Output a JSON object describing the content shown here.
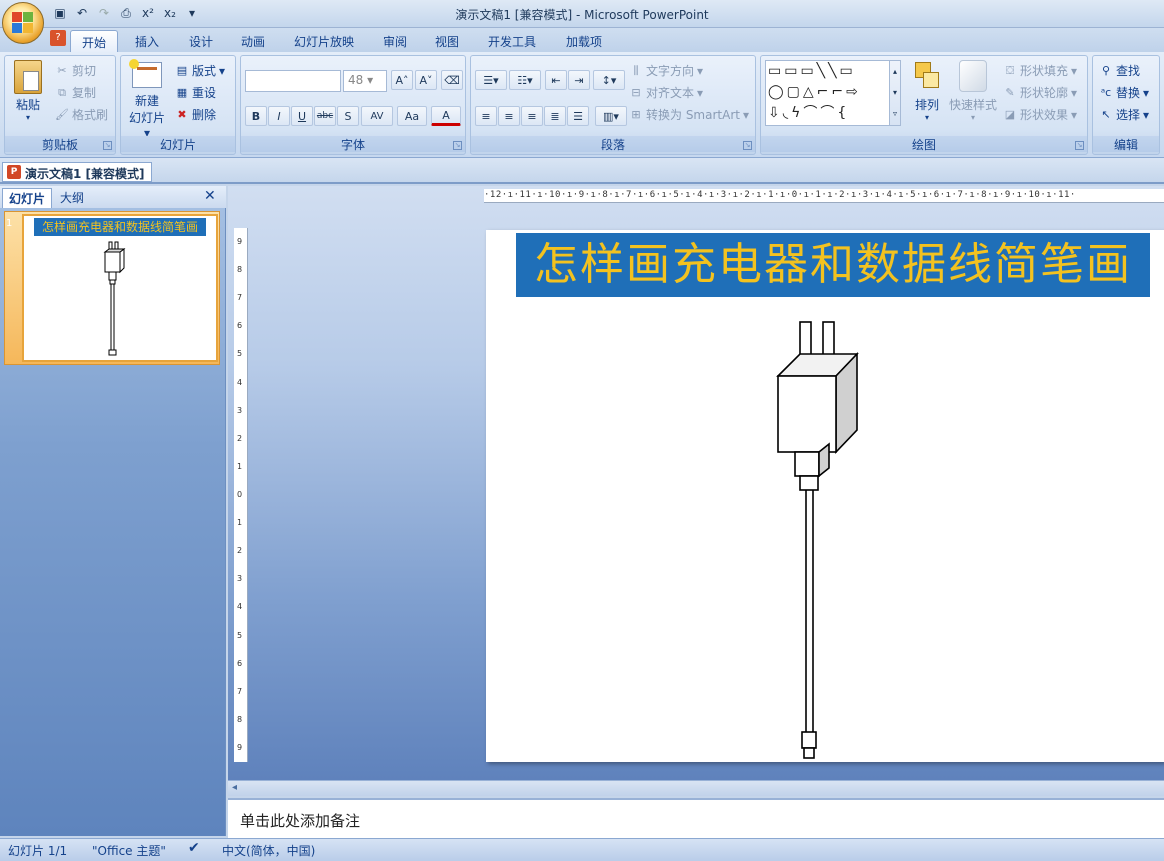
{
  "window": {
    "title": "演示文稿1 [兼容模式] - Microsoft PowerPoint"
  },
  "qat": {
    "items": [
      "save-icon",
      "undo-icon",
      "redo-icon",
      "print-preview-icon",
      "superscript-icon",
      "subscript-icon",
      "customize-icon"
    ],
    "superscript": "x²",
    "subscript": "x₂"
  },
  "ribbon_tabs": [
    "开始",
    "插入",
    "设计",
    "动画",
    "幻灯片放映",
    "审阅",
    "视图",
    "开发工具",
    "加载项"
  ],
  "clipboard": {
    "paste": "粘贴",
    "cut": "剪切",
    "copy": "复制",
    "format_painter": "格式刷",
    "label": "剪贴板"
  },
  "slides_group": {
    "new_slide_1": "新建",
    "new_slide_2": "幻灯片",
    "layout": "版式",
    "reset": "重设",
    "delete": "删除",
    "label": "幻灯片"
  },
  "font_group": {
    "font_size": "48",
    "label": "字体",
    "bold": "B",
    "italic": "I",
    "underline": "U",
    "strike": "abc",
    "shadow": "S",
    "spacing": "AV",
    "case": "Aa",
    "grow": "A",
    "shrink": "A"
  },
  "paragraph_group": {
    "text_direction": "文字方向",
    "align_text": "对齐文本",
    "smartart": "转换为 SmartArt",
    "label": "段落"
  },
  "drawing_group": {
    "arrange": "排列",
    "quick_styles": "快速样式",
    "shape_fill": "形状填充",
    "shape_outline": "形状轮廓",
    "shape_effects": "形状效果",
    "label": "绘图"
  },
  "editing_group": {
    "find": "查找",
    "replace": "替换",
    "select": "选择",
    "label": "编辑"
  },
  "doc_tab": "演示文稿1 [兼容模式]",
  "pane_tabs": {
    "slides": "幻灯片",
    "outline": "大纲"
  },
  "thumbnail": {
    "number": "1",
    "title": "怎样画充电器和数据线简笔画"
  },
  "ruler": {
    "h": "·12·ı·11·ı·10·ı·9·ı·8·ı·7·ı·6·ı·5·ı·4·ı·3·ı·2·ı·1·ı·0·ı·1·ı·2·ı·3·ı·4·ı·5·ı·6·ı·7·ı·8·ı·9·ı·10·ı·11·"
  },
  "vruler_ticks": [
    "9",
    "8",
    "7",
    "6",
    "5",
    "4",
    "3",
    "2",
    "1",
    "0",
    "1",
    "2",
    "3",
    "4",
    "5",
    "6",
    "7",
    "8",
    "9"
  ],
  "slide": {
    "title": "怎样画充电器和数据线简笔画",
    "title_bg": "#1f6fb8",
    "title_color": "#f3c21f"
  },
  "notes": {
    "placeholder": "单击此处添加备注"
  },
  "status": {
    "slide": "幻灯片 1/1",
    "theme": "\"Office 主题\"",
    "language": "中文(简体，中国)"
  }
}
